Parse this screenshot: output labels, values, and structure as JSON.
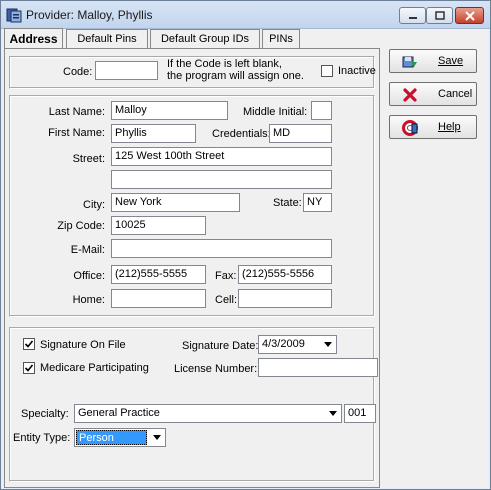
{
  "window": {
    "title": "Provider: Malloy, Phyllis"
  },
  "tabs": [
    {
      "label": "Address",
      "active": true
    },
    {
      "label": "Default Pins"
    },
    {
      "label": "Default Group IDs"
    },
    {
      "label": "PINs"
    }
  ],
  "code_section": {
    "code_label": "Code:",
    "code_value": "",
    "hint_line1": "If the Code is left blank,",
    "hint_line2": "the program will assign one.",
    "inactive_label": "Inactive",
    "inactive_checked": false
  },
  "address": {
    "last_name_label": "Last Name:",
    "last_name": "Malloy",
    "middle_initial_label": "Middle Initial:",
    "middle_initial": "",
    "first_name_label": "First Name:",
    "first_name": "Phyllis",
    "credentials_label": "Credentials:",
    "credentials": "MD",
    "street_label": "Street:",
    "street1": "125 West 100th Street",
    "street2": "",
    "city_label": "City:",
    "city": "New York",
    "state_label": "State:",
    "state": "NY",
    "zip_label": "Zip Code:",
    "zip": "10025",
    "email_label": "E-Mail:",
    "email": "",
    "office_label": "Office:",
    "office": "(212)555-5555",
    "fax_label": "Fax:",
    "fax": "(212)555-5556",
    "home_label": "Home:",
    "home": "",
    "cell_label": "Cell:",
    "cell": ""
  },
  "details": {
    "signature_on_file_label": "Signature On File",
    "signature_on_file": true,
    "signature_date_label": "Signature Date:",
    "signature_date": "4/3/2009",
    "medicare_label": "Medicare Participating",
    "medicare": true,
    "license_label": "License Number:",
    "license": "",
    "specialty_label": "Specialty:",
    "specialty": "General Practice",
    "specialty_code": "001",
    "entity_type_label": "Entity Type:",
    "entity_type": "Person"
  },
  "buttons": {
    "save": "Save",
    "cancel": "Cancel",
    "help": "Help"
  },
  "colors": {
    "selection": "#3399ff",
    "title_bar": "#c2d5ee",
    "close": "#c2412b"
  }
}
